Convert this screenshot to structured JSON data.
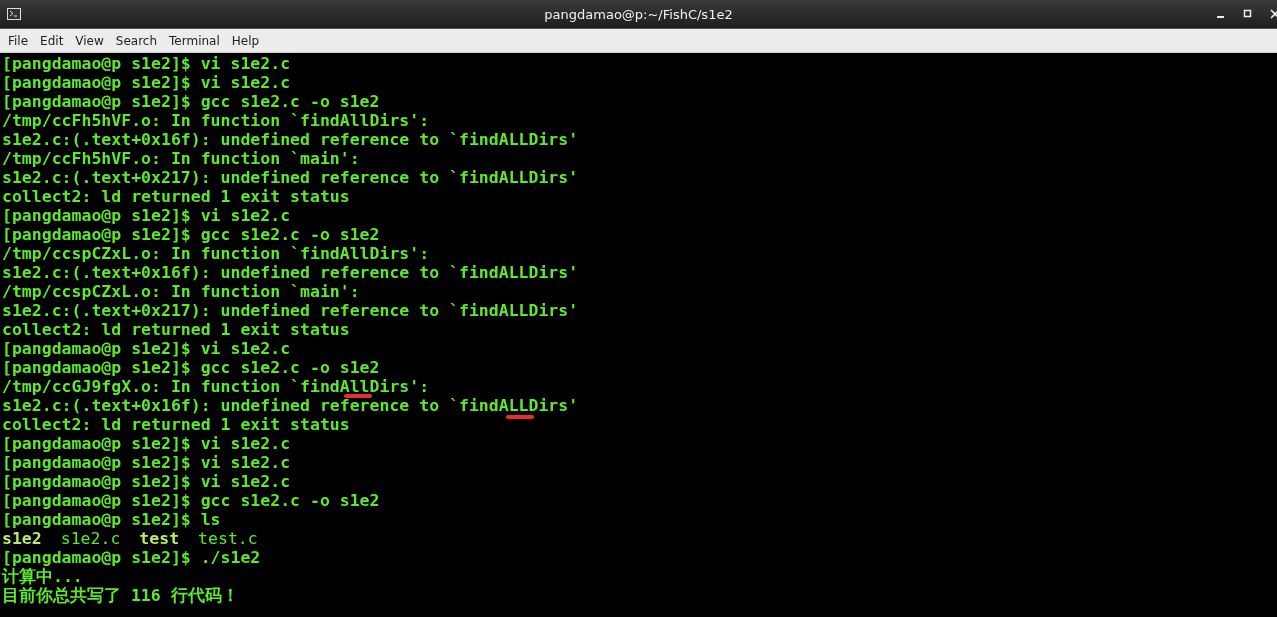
{
  "window": {
    "title": "pangdamao@p:~/FishC/s1e2"
  },
  "menu": [
    "File",
    "Edit",
    "View",
    "Search",
    "Terminal",
    "Help"
  ],
  "terminal_lines": [
    {
      "kind": "text",
      "text": "[pangdamao@p s1e2]$ vi s1e2.c"
    },
    {
      "kind": "text",
      "text": "[pangdamao@p s1e2]$ vi s1e2.c"
    },
    {
      "kind": "text",
      "text": "[pangdamao@p s1e2]$ gcc s1e2.c -o s1e2"
    },
    {
      "kind": "text",
      "text": "/tmp/ccFh5hVF.o: In function `findAllDirs':"
    },
    {
      "kind": "text",
      "text": "s1e2.c:(.text+0x16f): undefined reference to `findALLDirs'"
    },
    {
      "kind": "text",
      "text": "/tmp/ccFh5hVF.o: In function `main':"
    },
    {
      "kind": "text",
      "text": "s1e2.c:(.text+0x217): undefined reference to `findALLDirs'"
    },
    {
      "kind": "text",
      "text": "collect2: ld returned 1 exit status"
    },
    {
      "kind": "text",
      "text": "[pangdamao@p s1e2]$ vi s1e2.c"
    },
    {
      "kind": "text",
      "text": "[pangdamao@p s1e2]$ gcc s1e2.c -o s1e2"
    },
    {
      "kind": "text",
      "text": "/tmp/ccspCZxL.o: In function `findAllDirs':"
    },
    {
      "kind": "text",
      "text": "s1e2.c:(.text+0x16f): undefined reference to `findALLDirs'"
    },
    {
      "kind": "text",
      "text": "/tmp/ccspCZxL.o: In function `main':"
    },
    {
      "kind": "text",
      "text": "s1e2.c:(.text+0x217): undefined reference to `findALLDirs'"
    },
    {
      "kind": "text",
      "text": "collect2: ld returned 1 exit status"
    },
    {
      "kind": "text",
      "text": "[pangdamao@p s1e2]$ vi s1e2.c"
    },
    {
      "kind": "text",
      "text": "[pangdamao@p s1e2]$ gcc s1e2.c -o s1e2"
    },
    {
      "kind": "text",
      "text": "/tmp/ccGJ9fgX.o: In function `findAllDirs':"
    },
    {
      "kind": "text",
      "text": "s1e2.c:(.text+0x16f): undefined reference to `findALLDirs'"
    },
    {
      "kind": "text",
      "text": "collect2: ld returned 1 exit status"
    },
    {
      "kind": "text",
      "text": "[pangdamao@p s1e2]$ vi s1e2.c"
    },
    {
      "kind": "text",
      "text": "[pangdamao@p s1e2]$ vi s1e2.c"
    },
    {
      "kind": "text",
      "text": "[pangdamao@p s1e2]$ vi s1e2.c"
    },
    {
      "kind": "text",
      "text": "[pangdamao@p s1e2]$ gcc s1e2.c -o s1e2"
    },
    {
      "kind": "text",
      "text": "[pangdamao@p s1e2]$ ls"
    },
    {
      "kind": "listing",
      "files": [
        {
          "name": "s1e2",
          "executable": true
        },
        {
          "name": "s1e2.c",
          "executable": false
        },
        {
          "name": "test",
          "executable": true
        },
        {
          "name": "test.c",
          "executable": false
        }
      ]
    },
    {
      "kind": "text",
      "text": "[pangdamao@p s1e2]$ ./s1e2"
    },
    {
      "kind": "text",
      "text": "计算中..."
    },
    {
      "kind": "text",
      "text": "目前你总共写了 116 行代码！"
    }
  ]
}
